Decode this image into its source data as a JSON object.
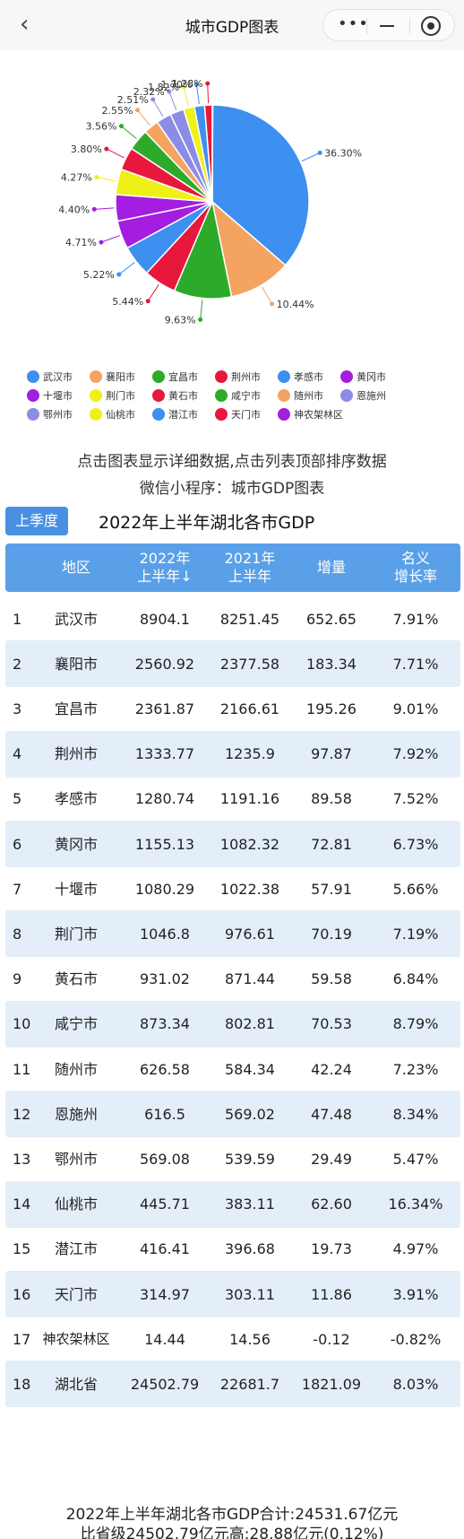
{
  "nav": {
    "back_icon": "chevron-left-icon",
    "title": "城市GDP图表",
    "more_icon": "more-dots-icon",
    "minimize_icon": "minimize-icon",
    "close_icon": "target-close-icon"
  },
  "chart_data": {
    "type": "pie",
    "title": "",
    "slices": [
      {
        "name": "武汉市",
        "percent": 36.3,
        "label": "36.30%",
        "color": "#3d8ff0"
      },
      {
        "name": "襄阳市",
        "percent": 10.44,
        "label": "10.44%",
        "color": "#f4a361"
      },
      {
        "name": "宜昌市",
        "percent": 9.63,
        "label": "9.63%",
        "color": "#2eaa2a"
      },
      {
        "name": "荆州市",
        "percent": 5.44,
        "label": "5.44%",
        "color": "#e8173c"
      },
      {
        "name": "孝感市",
        "percent": 5.22,
        "label": "5.22%",
        "color": "#3d8ff0"
      },
      {
        "name": "黄冈市",
        "percent": 4.71,
        "label": "4.71%",
        "color": "#a31ee0"
      },
      {
        "name": "十堰市",
        "percent": 4.4,
        "label": "4.40%",
        "color": "#a31ee0"
      },
      {
        "name": "荆门市",
        "percent": 4.27,
        "label": "4.27%",
        "color": "#eef017"
      },
      {
        "name": "黄石市",
        "percent": 3.8,
        "label": "3.80%",
        "color": "#e8173c"
      },
      {
        "name": "咸宁市",
        "percent": 3.56,
        "label": "3.56%",
        "color": "#2eaa2a"
      },
      {
        "name": "随州市",
        "percent": 2.55,
        "label": "2.55%",
        "color": "#f4a361"
      },
      {
        "name": "恩施州",
        "percent": 2.51,
        "label": "2.51%",
        "color": "#8c8ce6"
      },
      {
        "name": "鄂州市",
        "percent": 2.32,
        "label": "2.32%",
        "color": "#8c8ce6"
      },
      {
        "name": "仙桃市",
        "percent": 1.82,
        "label": "1.82%",
        "color": "#eef017"
      },
      {
        "name": "潜江市",
        "percent": 1.7,
        "label": "1.70%",
        "color": "#3d8ff0"
      },
      {
        "name": "天门市",
        "percent": 1.28,
        "label": "1.28%",
        "color": "#e8173c"
      },
      {
        "name": "神农架林区",
        "percent": 0.06,
        "label": "",
        "color": "#a31ee0"
      }
    ]
  },
  "legend": [
    {
      "label": "武汉市",
      "color": "#3d8ff0"
    },
    {
      "label": "襄阳市",
      "color": "#f4a361"
    },
    {
      "label": "宜昌市",
      "color": "#2eaa2a"
    },
    {
      "label": "荆州市",
      "color": "#e8173c"
    },
    {
      "label": "孝感市",
      "color": "#3d8ff0"
    },
    {
      "label": "黄冈市",
      "color": "#a31ee0"
    },
    {
      "label": "十堰市",
      "color": "#a31ee0"
    },
    {
      "label": "荆门市",
      "color": "#eef017"
    },
    {
      "label": "黄石市",
      "color": "#e8173c"
    },
    {
      "label": "咸宁市",
      "color": "#2eaa2a"
    },
    {
      "label": "随州市",
      "color": "#f4a361"
    },
    {
      "label": "恩施州",
      "color": "#8c8ce6"
    },
    {
      "label": "鄂州市",
      "color": "#8c8ce6"
    },
    {
      "label": "仙桃市",
      "color": "#eef017"
    },
    {
      "label": "潜江市",
      "color": "#3d8ff0"
    },
    {
      "label": "天门市",
      "color": "#e8173c"
    },
    {
      "label": "神农架林区",
      "color": "#a31ee0"
    }
  ],
  "hints": {
    "line1": "点击图表显示详细数据,点击列表顶部排序数据",
    "line2": "微信小程序：城市GDP图表"
  },
  "season_button": "上季度",
  "table": {
    "title": "2022年上半年湖北各市GDP",
    "headers": {
      "region": "地区",
      "h2022_line1": "2022年",
      "h2022_line2": "上半年↓",
      "h2021_line1": "2021年",
      "h2021_line2": "上半年",
      "increase": "增量",
      "rate_line1": "名义",
      "rate_line2": "增长率"
    },
    "rows": [
      {
        "idx": "1",
        "region": "武汉市",
        "gdp2022": "8904.1",
        "gdp2021": "8251.45",
        "increase": "652.65",
        "rate": "7.91%"
      },
      {
        "idx": "2",
        "region": "襄阳市",
        "gdp2022": "2560.92",
        "gdp2021": "2377.58",
        "increase": "183.34",
        "rate": "7.71%"
      },
      {
        "idx": "3",
        "region": "宜昌市",
        "gdp2022": "2361.87",
        "gdp2021": "2166.61",
        "increase": "195.26",
        "rate": "9.01%"
      },
      {
        "idx": "4",
        "region": "荆州市",
        "gdp2022": "1333.77",
        "gdp2021": "1235.9",
        "increase": "97.87",
        "rate": "7.92%"
      },
      {
        "idx": "5",
        "region": "孝感市",
        "gdp2022": "1280.74",
        "gdp2021": "1191.16",
        "increase": "89.58",
        "rate": "7.52%"
      },
      {
        "idx": "6",
        "region": "黄冈市",
        "gdp2022": "1155.13",
        "gdp2021": "1082.32",
        "increase": "72.81",
        "rate": "6.73%"
      },
      {
        "idx": "7",
        "region": "十堰市",
        "gdp2022": "1080.29",
        "gdp2021": "1022.38",
        "increase": "57.91",
        "rate": "5.66%"
      },
      {
        "idx": "8",
        "region": "荆门市",
        "gdp2022": "1046.8",
        "gdp2021": "976.61",
        "increase": "70.19",
        "rate": "7.19%"
      },
      {
        "idx": "9",
        "region": "黄石市",
        "gdp2022": "931.02",
        "gdp2021": "871.44",
        "increase": "59.58",
        "rate": "6.84%"
      },
      {
        "idx": "10",
        "region": "咸宁市",
        "gdp2022": "873.34",
        "gdp2021": "802.81",
        "increase": "70.53",
        "rate": "8.79%"
      },
      {
        "idx": "11",
        "region": "随州市",
        "gdp2022": "626.58",
        "gdp2021": "584.34",
        "increase": "42.24",
        "rate": "7.23%"
      },
      {
        "idx": "12",
        "region": "恩施州",
        "gdp2022": "616.5",
        "gdp2021": "569.02",
        "increase": "47.48",
        "rate": "8.34%"
      },
      {
        "idx": "13",
        "region": "鄂州市",
        "gdp2022": "569.08",
        "gdp2021": "539.59",
        "increase": "29.49",
        "rate": "5.47%"
      },
      {
        "idx": "14",
        "region": "仙桃市",
        "gdp2022": "445.71",
        "gdp2021": "383.11",
        "increase": "62.60",
        "rate": "16.34%"
      },
      {
        "idx": "15",
        "region": "潜江市",
        "gdp2022": "416.41",
        "gdp2021": "396.68",
        "increase": "19.73",
        "rate": "4.97%"
      },
      {
        "idx": "16",
        "region": "天门市",
        "gdp2022": "314.97",
        "gdp2021": "303.11",
        "increase": "11.86",
        "rate": "3.91%"
      },
      {
        "idx": "17",
        "region": "神农架林区",
        "gdp2022": "14.44",
        "gdp2021": "14.56",
        "increase": "-0.12",
        "rate": "-0.82%"
      },
      {
        "idx": "18",
        "region": "湖北省",
        "gdp2022": "24502.79",
        "gdp2021": "22681.7",
        "increase": "1821.09",
        "rate": "8.03%"
      }
    ]
  },
  "footer": {
    "line1": "2022年上半年湖北各市GDP合计:24531.67亿元",
    "line2": "比省级24502.79亿元高:28.88亿元(0.12%)"
  }
}
